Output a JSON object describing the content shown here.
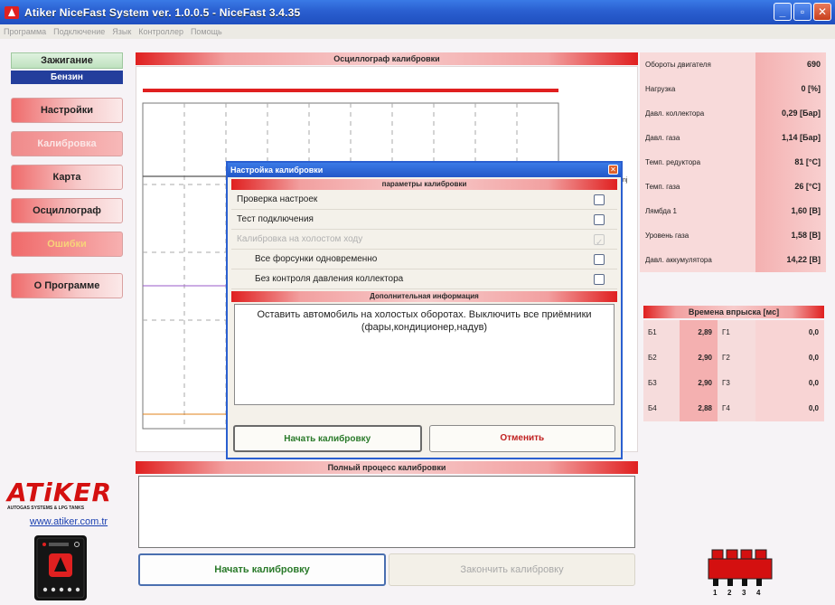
{
  "window": {
    "title": "Atiker NiceFast System ver. 1.0.0.5  -  NiceFast   3.4.35",
    "minimize": "_",
    "maximize": "▫",
    "close": "✕"
  },
  "menu": [
    "Программа",
    "Подключение",
    "Язык",
    "Контроллер",
    "Помощь"
  ],
  "nav": {
    "ignition": "Зажигание",
    "fuel": "Бензин",
    "settings": "Настройки",
    "calibration": "Калибровка",
    "map": "Карта",
    "oscillograph": "Осциллограф",
    "errors": "Ошибки",
    "about": "О Программе"
  },
  "osc": {
    "title": "Осциллограф калибровки",
    "cut_label": "Inj"
  },
  "sensors": [
    {
      "label": "Обороты двигателя",
      "value": "690"
    },
    {
      "label": "Нагрузка",
      "value": "0 [%]"
    },
    {
      "label": "Давл. коллектора",
      "value": "0,29 [Бар]"
    },
    {
      "label": "Давл. газа",
      "value": "1,14 [Бар]"
    },
    {
      "label": "Темп. редуктора",
      "value": "81 [°C]"
    },
    {
      "label": "Темп. газа",
      "value": "26 [°C]"
    },
    {
      "label": "Лямбда 1",
      "value": "1,60 [В]"
    },
    {
      "label": "Уровень газа",
      "value": "1,58 [В]"
    },
    {
      "label": "Давл. аккумулятора",
      "value": "14,22 [В]"
    }
  ],
  "injection": {
    "title": "Времена впрыска [мс]",
    "rows": [
      {
        "b": "Б1",
        "bv": "2,89",
        "g": "Г1",
        "gv": "0,0"
      },
      {
        "b": "Б2",
        "bv": "2,90",
        "g": "Г2",
        "gv": "0,0"
      },
      {
        "b": "Б3",
        "bv": "2,90",
        "g": "Г3",
        "gv": "0,0"
      },
      {
        "b": "Б4",
        "bv": "2,88",
        "g": "Г4",
        "gv": "0,0"
      }
    ]
  },
  "dialog": {
    "title": "Настройка калибровки",
    "params_header": "параметры калибровки",
    "options": [
      {
        "label": "Проверка настроек",
        "checked": false,
        "disabled": false,
        "indent": false
      },
      {
        "label": "Тест подключения",
        "checked": false,
        "disabled": false,
        "indent": false
      },
      {
        "label": "Калибровка на холостом ходу",
        "checked": true,
        "disabled": true,
        "indent": false
      },
      {
        "label": "Все форсунки одновременно",
        "checked": false,
        "disabled": false,
        "indent": true
      },
      {
        "label": "Без контроля давления коллектора",
        "checked": false,
        "disabled": false,
        "indent": true
      }
    ],
    "info_header": "Дополнительная информация",
    "info_text": "Оставить автомобиль на холостых оборотах. Выключить все приёмники (фары,кондиционер,надув)",
    "start_button": "Начать калибровку",
    "cancel_button": "Отменить"
  },
  "process": {
    "title": "Полный процесс калибровки",
    "start_button": "Начать калибровку",
    "finish_button": "Закончить калибровку"
  },
  "brand": {
    "logo": "ATiKER",
    "subtitle": "AUTOGAS SYSTEMS & LPG TANKS",
    "url": "www.atiker.com.tr"
  },
  "injector_numbers": [
    "1",
    "2",
    "3",
    "4"
  ],
  "colors": {
    "accent_red": "#e02020",
    "title_blue": "#2a5fd0",
    "fuel_blue": "#233e9c"
  }
}
